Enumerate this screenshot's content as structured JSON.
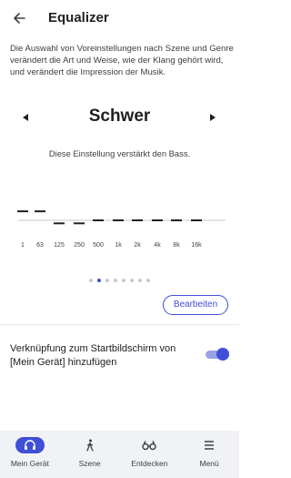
{
  "header": {
    "title": "Equalizer",
    "back_icon": "arrow-left-icon"
  },
  "description": "Die Auswahl von Voreinstellungen nach Szene und Genre verändert die Art und Weise, wie der Klang gehört wird, und verändert die Impression der Musik.",
  "preset": {
    "name": "Schwer",
    "description": "Diese Einstellung verstärkt den Bass.",
    "prev_icon": "triangle-left-icon",
    "next_icon": "triangle-right-icon"
  },
  "chart_data": {
    "type": "bar",
    "categories": [
      "1",
      "63",
      "125",
      "250",
      "500",
      "1k",
      "2k",
      "4k",
      "8k",
      "16k"
    ],
    "values": [
      3,
      3,
      -1,
      -1,
      0,
      0,
      0,
      0,
      0,
      0
    ],
    "ylim": [
      -6,
      6
    ],
    "title": "",
    "xlabel": "",
    "ylabel": ""
  },
  "pagination": {
    "count": 8,
    "active_index": 1
  },
  "edit_button": "Bearbeiten",
  "shortcut": {
    "label": "Verknüpfung zum Startbildschirm von [Mein Gerät] hinzufügen",
    "enabled": true
  },
  "colors": {
    "accent": "#3f4fd6",
    "toggle_track": "#9aa2e6",
    "nav_background": "#f1f2f6"
  },
  "bottom_nav": [
    {
      "label": "Mein Gerät",
      "icon": "headphones-icon",
      "active": true
    },
    {
      "label": "Szene",
      "icon": "walking-person-icon",
      "active": false
    },
    {
      "label": "Entdecken",
      "icon": "binoculars-icon",
      "active": false
    },
    {
      "label": "Menü",
      "icon": "menu-icon",
      "active": false
    }
  ]
}
